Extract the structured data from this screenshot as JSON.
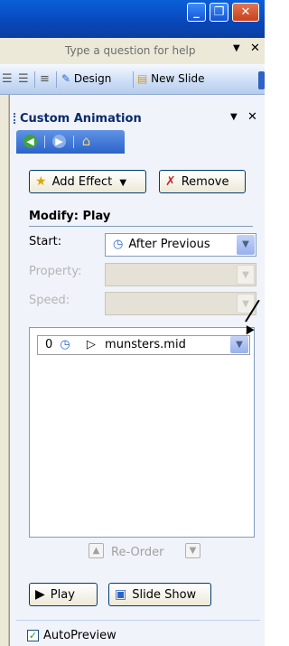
{
  "window": {
    "minimize_glyph": "_",
    "restore_glyph": "❐",
    "close_glyph": "✕"
  },
  "helpbar": {
    "placeholder": "Type a question for help",
    "dropdown_glyph": "▼",
    "close_glyph": "✕"
  },
  "toolbar": {
    "design_label": "Design",
    "new_slide_label": "New Slide"
  },
  "pane": {
    "title": "Custom Animation",
    "menu_glyph": "▼",
    "close_glyph": "✕",
    "nav_icons": [
      "back-icon",
      "forward-icon",
      "home-icon"
    ],
    "add_effect_label": "Add Effect",
    "add_effect_arrow": "▼",
    "remove_label": "Remove",
    "modify_heading": "Modify: Play",
    "start_label": "Start:",
    "start_value": "After Previous",
    "property_label": "Property:",
    "speed_label": "Speed:",
    "list_items": [
      {
        "order": "0",
        "name": "munsters.mid"
      }
    ],
    "reorder_label": "Re-Order",
    "play_label": "Play",
    "slideshow_label": "Slide Show",
    "autopreview_label": "AutoPreview",
    "autopreview_checked": true
  },
  "colors": {
    "accent": "#2b63c9",
    "pane_bg": "#f0f3fa",
    "title_text": "#0b2a6b"
  }
}
